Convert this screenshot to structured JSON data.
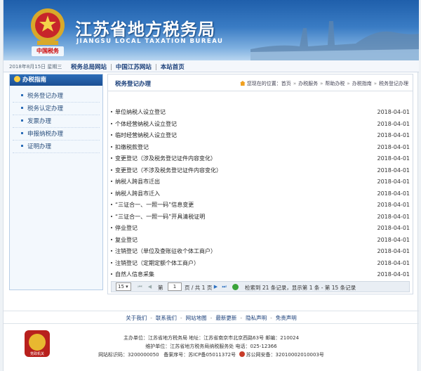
{
  "header": {
    "title": "江苏省地方税务局",
    "subtitle": "JIANGSU LOCAL TAXATION BUREAU",
    "emblem_tag": "中国税务"
  },
  "topbar": {
    "date": "2018年8月15日 星期三",
    "links": [
      "税务总局网站",
      "中国江苏网站",
      "本站首页"
    ]
  },
  "sidebar": {
    "heading": "办税指南",
    "items": [
      "税务登记办理",
      "税务认定办理",
      "发票办理",
      "申报纳税办理",
      "证明办理"
    ]
  },
  "content": {
    "title": "税务登记办理",
    "breadcrumb": [
      "您现在的位置：首页",
      "办税服务",
      "帮助办税",
      "办税指南",
      "税务登记办理"
    ],
    "items": [
      {
        "label": "单位纳税人设立登记",
        "date": "2018-04-01"
      },
      {
        "label": "个体经营纳税人设立登记",
        "date": "2018-04-01"
      },
      {
        "label": "临时经营纳税人设立登记",
        "date": "2018-04-01"
      },
      {
        "label": "扣缴税款登记",
        "date": "2018-04-01"
      },
      {
        "label": "变更登记（涉及税务登记证件内容变化）",
        "date": "2018-04-01"
      },
      {
        "label": "变更登记（不涉及税务登记证件内容变化）",
        "date": "2018-04-01"
      },
      {
        "label": "纳税人跨县市迁出",
        "date": "2018-04-01"
      },
      {
        "label": "纳税人跨县市迁入",
        "date": "2018-04-01"
      },
      {
        "label": "“三证合一、一照一码”信息变更",
        "date": "2018-04-01"
      },
      {
        "label": "“三证合一、一照一码”开具清税证明",
        "date": "2018-04-01"
      },
      {
        "label": "停业登记",
        "date": "2018-04-01"
      },
      {
        "label": "复业登记",
        "date": "2018-04-01"
      },
      {
        "label": "注销登记（单位及查账征收个体工商户）",
        "date": "2018-04-01"
      },
      {
        "label": "注销登记（定期定额个体工商户）",
        "date": "2018-04-01"
      },
      {
        "label": "自然人信息采集",
        "date": "2018-04-01"
      }
    ]
  },
  "pager": {
    "page_size": "15",
    "page_label_pre": "第",
    "current_page": "1",
    "page_label_post": "页 / 共 1 页",
    "summary": "检索到 21 条记录，显示第 1 条 - 第 15 条记录"
  },
  "footer": {
    "links": [
      "关于我们",
      "联系我们",
      "网站地图",
      "最新更新",
      "隐私声明",
      "免责声明"
    ],
    "sponsor": "主办单位：江苏省地方税务局 地址：江苏省南京市北京西路63号 邮编：210024",
    "maintainer": "维护单位：江苏省地方税务局纳税服务处 电话：025-12366",
    "site_code": "网站标识码：3200000050",
    "icp": "备案序号：苏ICP备05011372号",
    "police": "苏公网安备：32010002010003号",
    "emblem_caption": "党政机关"
  }
}
